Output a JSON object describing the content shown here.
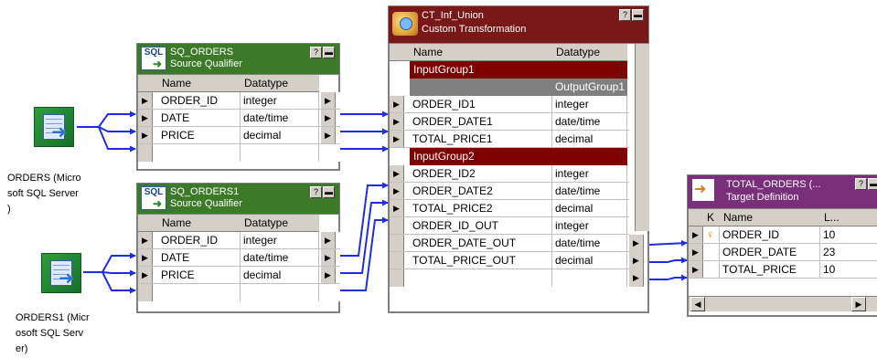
{
  "sources": [
    {
      "label": "ORDERS (Micro soft SQL Server )",
      "label_lines": [
        "ORDERS (Micro",
        "soft SQL Server",
        ")"
      ]
    },
    {
      "label": "ORDERS1 (Micr osoft SQL Serv er)",
      "label_lines": [
        "ORDERS1 (Micr",
        "osoft SQL Serv",
        "er)"
      ]
    }
  ],
  "sq_orders": {
    "title": "SQ_ORDERS",
    "subtitle": "Source Qualifier",
    "icon": "sql-source-qualifier-icon",
    "headers": [
      "Name",
      "Datatype"
    ],
    "rows": [
      {
        "name": "ORDER_ID",
        "type": "integer"
      },
      {
        "name": "DATE",
        "type": "date/time"
      },
      {
        "name": "PRICE",
        "type": "decimal"
      }
    ]
  },
  "sq_orders1": {
    "title": "SQ_ORDERS1",
    "subtitle": "Source Qualifier",
    "icon": "sql-source-qualifier-icon",
    "headers": [
      "Name",
      "Datatype"
    ],
    "rows": [
      {
        "name": "ORDER_ID",
        "type": "integer"
      },
      {
        "name": "DATE",
        "type": "date/time"
      },
      {
        "name": "PRICE",
        "type": "decimal"
      }
    ]
  },
  "ct": {
    "title": "CT_Inf_Union",
    "subtitle": "Custom Transformation",
    "icon": "custom-transformation-icon",
    "headers": [
      "Name",
      "Datatype"
    ],
    "input_group1": "InputGroup1",
    "output_group1": "OutputGroup1",
    "group1_rows": [
      {
        "name": "ORDER_ID1",
        "type": "integer"
      },
      {
        "name": "ORDER_DATE1",
        "type": "date/time"
      },
      {
        "name": "TOTAL_PRICE1",
        "type": "decimal"
      }
    ],
    "input_group2": "InputGroup2",
    "group2_rows": [
      {
        "name": "ORDER_ID2",
        "type": "integer"
      },
      {
        "name": "ORDER_DATE2",
        "type": "date/time"
      },
      {
        "name": "TOTAL_PRICE2",
        "type": "decimal"
      }
    ],
    "out_rows": [
      {
        "name": "ORDER_ID_OUT",
        "type": "integer"
      },
      {
        "name": "ORDER_DATE_OUT",
        "type": "date/time"
      },
      {
        "name": "TOTAL_PRICE_OUT",
        "type": "decimal"
      }
    ]
  },
  "target": {
    "title": "TOTAL_ORDERS (...",
    "subtitle": "Target Definition",
    "icon": "target-definition-icon",
    "headers": [
      "K",
      "Name",
      "L..."
    ],
    "rows": [
      {
        "key": true,
        "name": "ORDER_ID",
        "len": "10"
      },
      {
        "key": false,
        "name": "ORDER_DATE",
        "len": "23"
      },
      {
        "key": false,
        "name": "TOTAL_PRICE",
        "len": "10"
      }
    ]
  },
  "glyphs": {
    "port_arrow": "▶",
    "help": "?",
    "minimize": "▬",
    "scroll_left": "◀",
    "scroll_right": "▶",
    "key": "🔑"
  },
  "colors": {
    "link": "#1f2fe0",
    "sq_title": "#3c7a2a",
    "ct_title": "#7a1717",
    "target_title": "#7a2f7a",
    "group": "#800000"
  }
}
